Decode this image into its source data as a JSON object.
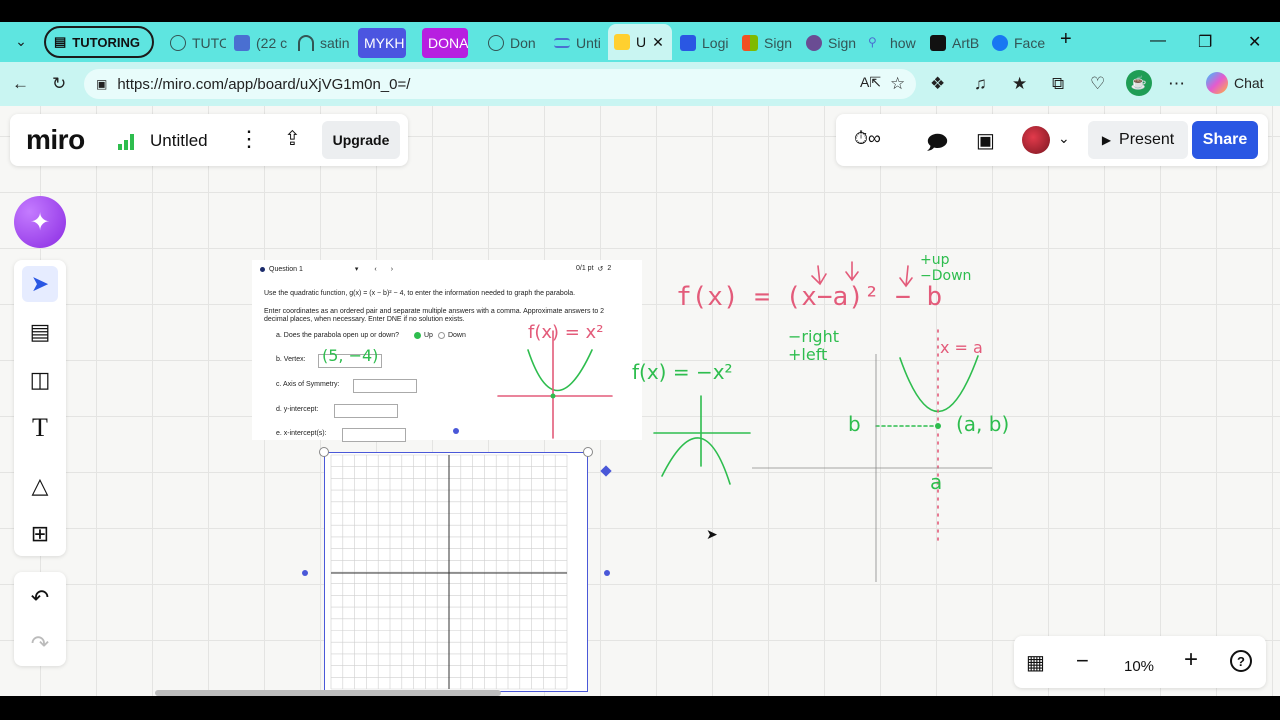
{
  "browser": {
    "tab_group_label": "TUTORING",
    "tabs": [
      {
        "label": "TUTO",
        "icon": "globe-icon"
      },
      {
        "label": "(22 c",
        "icon": "mail-icon"
      },
      {
        "label": "satin",
        "icon": "horseshoe-icon"
      },
      {
        "label": "MYKH",
        "icon": "tag-icon"
      },
      {
        "label": "DONA",
        "icon": "tag-icon"
      },
      {
        "label": "Don",
        "icon": "globe-icon"
      },
      {
        "label": "Unti",
        "icon": "doc-icon"
      },
      {
        "label": "U",
        "icon": "miro-icon"
      },
      {
        "label": "Logi",
        "icon": "aol-icon"
      },
      {
        "label": "Sign",
        "icon": "microsoft-icon"
      },
      {
        "label": "Sign",
        "icon": "github-icon"
      },
      {
        "label": "how",
        "icon": "search-icon"
      },
      {
        "label": "ArtB",
        "icon": "tiktok-icon"
      },
      {
        "label": "Face",
        "icon": "facebook-icon"
      }
    ],
    "url": "https://miro.com/app/board/uXjVG1m0n_0=/",
    "chat_label": "Chat"
  },
  "miro": {
    "logo": "miro",
    "board_name": "Untitled",
    "upgrade_label": "Upgrade",
    "present_label": "Present",
    "share_label": "Share",
    "zoom_level": "10%"
  },
  "worksheet": {
    "question_label": "Question 1",
    "score": "0/1 pt",
    "attempts": "2",
    "instruction": "Use the quadratic function, g(x) = (x − b)² − 4, to enter the information needed to graph the parabola.",
    "instruction2": "Enter coordinates as an ordered pair and separate multiple answers with a comma. Approximate answers to 2 decimal places, when necessary. Enter DNE if no solution exists.",
    "items": [
      {
        "label": "a.   Does the parabola open up or down?"
      },
      {
        "label": "b.   Vertex:"
      },
      {
        "label": "c.   Axis of Symmetry:"
      },
      {
        "label": "d.   y-intercept:"
      },
      {
        "label": "e.   x-intercept(s):"
      }
    ],
    "opt_up": "Up",
    "opt_down": "Down"
  },
  "handwriting": {
    "fx_general": "f(x) = (x−a)² − b",
    "up_down": "+up  −Down",
    "right_left": "−right  +left",
    "fx_neg": "f(x) = −x²",
    "fx_pos": "f(x) = x²",
    "vertex_ws": "(5, −4)",
    "axis_eq": "x = a",
    "vertex_ab": "(a, b)",
    "label_b": "b",
    "label_a": "a"
  },
  "colors": {
    "accent": "#2a57e3",
    "tab_bg": "#5ee5e0",
    "ink_green": "#2ebd4e",
    "ink_pink": "#e35b7a"
  }
}
